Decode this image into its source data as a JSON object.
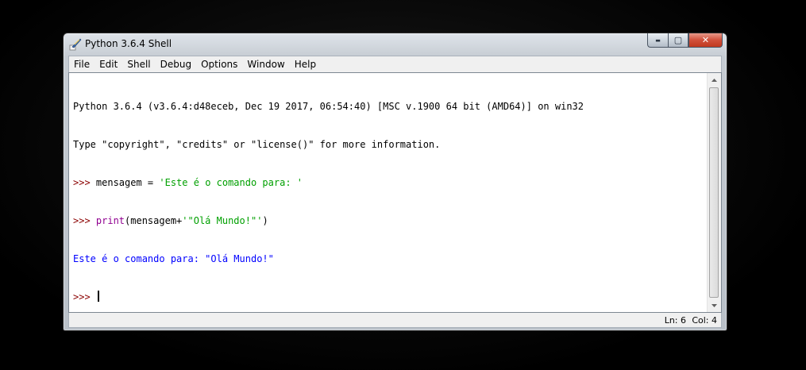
{
  "window": {
    "title": "Python 3.6.4 Shell",
    "minimize_glyph": "▬",
    "maximize_glyph": "▢",
    "close_glyph": "✕"
  },
  "menu": [
    "File",
    "Edit",
    "Shell",
    "Debug",
    "Options",
    "Window",
    "Help"
  ],
  "shell": {
    "banner1": "Python 3.6.4 (v3.6.4:d48eceb, Dec 19 2017, 06:54:40) [MSC v.1900 64 bit (AMD64)] on win32",
    "banner2": "Type \"copyright\", \"credits\" or \"license()\" for more information.",
    "prompt": ">>> ",
    "line1_code": "mensagem = ",
    "line1_string": "'Este é o comando para: '",
    "line2_builtin": "print",
    "line2_code_a": "(mensagem+",
    "line2_string": "'\"Olá Mundo!\"'",
    "line2_code_b": ")",
    "output": "Este é o comando para: \"Olá Mundo!\""
  },
  "status": {
    "ln": "Ln: 6",
    "col": "Col: 4"
  },
  "colors": {
    "prompt": "#8b0000",
    "string": "#00a000",
    "builtin": "#900090",
    "stdout": "#0000ff"
  },
  "icons": {
    "app": "python-feather-icon",
    "scroll_up": "arrow-up-icon",
    "scroll_down": "arrow-down-icon"
  }
}
